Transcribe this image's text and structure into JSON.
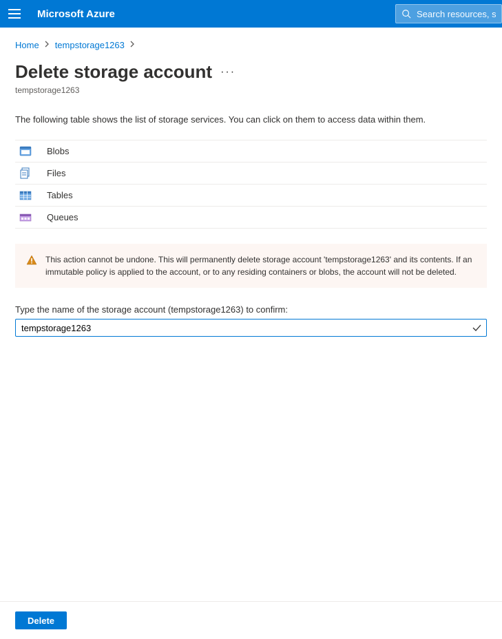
{
  "header": {
    "brand": "Microsoft Azure",
    "search_placeholder": "Search resources, services, and docs"
  },
  "breadcrumb": {
    "items": [
      "Home",
      "tempstorage1263"
    ]
  },
  "page": {
    "title": "Delete storage account",
    "subtitle": "tempstorage1263",
    "description": "The following table shows the list of storage services. You can click on them to access data within them."
  },
  "services": [
    {
      "label": "Blobs"
    },
    {
      "label": "Files"
    },
    {
      "label": "Tables"
    },
    {
      "label": "Queues"
    }
  ],
  "warning": {
    "text": "This action cannot be undone. This will permanently delete storage account 'tempstorage1263' and its contents. If an immutable policy is applied to the account, or to any residing containers or blobs, the account will not be deleted."
  },
  "confirm": {
    "label": "Type the name of the storage account (tempstorage1263) to confirm:",
    "value": "tempstorage1263"
  },
  "footer": {
    "delete_label": "Delete"
  }
}
